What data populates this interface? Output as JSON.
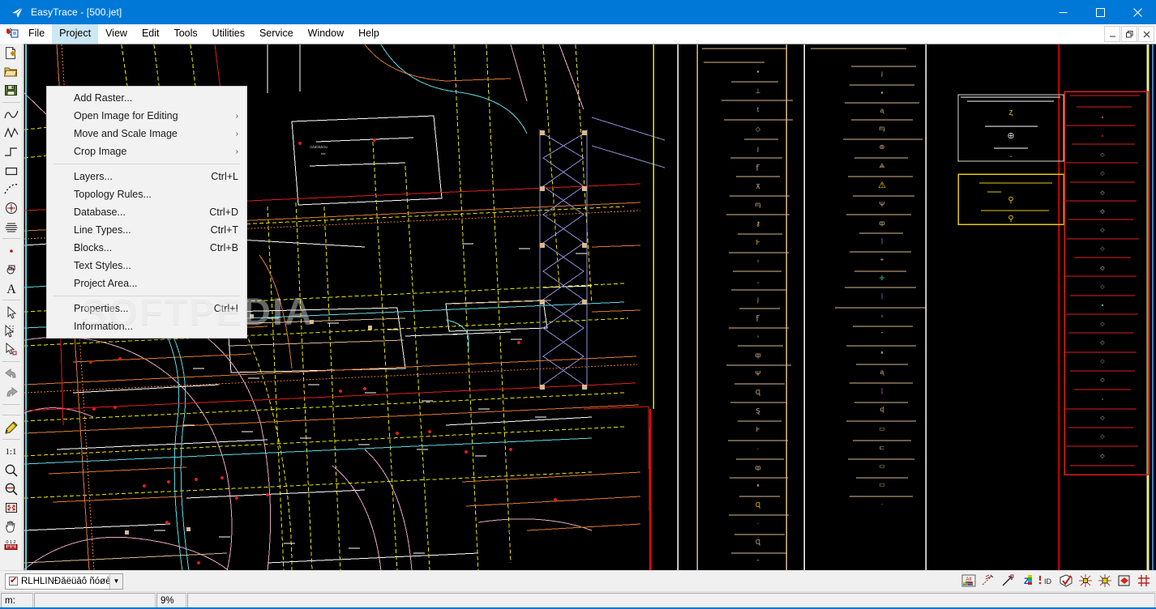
{
  "window": {
    "title": "EasyTrace - [500.jet]",
    "app_icon": "easytrace-logo-icon",
    "controls": {
      "minimize": "–",
      "maximize": "☐",
      "close": "✕"
    }
  },
  "mdi": {
    "doc_icon": "mdi-document-icon",
    "controls": {
      "minimize": "_",
      "restore": "❐",
      "close": "✕"
    }
  },
  "menubar": {
    "items": [
      {
        "label": "File",
        "name": "menu-file",
        "active": false
      },
      {
        "label": "Project",
        "name": "menu-project",
        "active": true
      },
      {
        "label": "View",
        "name": "menu-view",
        "active": false
      },
      {
        "label": "Edit",
        "name": "menu-edit",
        "active": false
      },
      {
        "label": "Tools",
        "name": "menu-tools",
        "active": false
      },
      {
        "label": "Utilities",
        "name": "menu-utilities",
        "active": false
      },
      {
        "label": "Service",
        "name": "menu-service",
        "active": false
      },
      {
        "label": "Window",
        "name": "menu-window",
        "active": false
      },
      {
        "label": "Help",
        "name": "menu-help",
        "active": false
      }
    ]
  },
  "project_menu": {
    "items": [
      {
        "label": "Add Raster...",
        "accel": "",
        "submenu": false
      },
      {
        "label": "Open Image for Editing",
        "accel": "",
        "submenu": true
      },
      {
        "label": "Move and Scale Image",
        "accel": "",
        "submenu": true
      },
      {
        "label": "Crop Image",
        "accel": "",
        "submenu": true
      },
      {
        "separator": true
      },
      {
        "label": "Layers...",
        "accel": "Ctrl+L",
        "submenu": false
      },
      {
        "label": "Topology Rules...",
        "accel": "",
        "submenu": false
      },
      {
        "label": "Database...",
        "accel": "Ctrl+D",
        "submenu": false
      },
      {
        "label": "Line Types...",
        "accel": "Ctrl+T",
        "submenu": false
      },
      {
        "label": "Blocks...",
        "accel": "Ctrl+B",
        "submenu": false
      },
      {
        "label": "Text Styles...",
        "accel": "",
        "submenu": false
      },
      {
        "label": "Project Area...",
        "accel": "",
        "submenu": false
      },
      {
        "separator": true
      },
      {
        "label": "Properties...",
        "accel": "Ctrl+I",
        "submenu": false
      },
      {
        "label": "Information...",
        "accel": "",
        "submenu": false
      }
    ],
    "submenu_arrow": "›"
  },
  "left_toolbar": {
    "groups": [
      {
        "buttons": [
          {
            "name": "new-document-button",
            "icon": "new-document-icon"
          },
          {
            "name": "open-folder-button",
            "icon": "open-folder-icon"
          },
          {
            "name": "save-button",
            "icon": "floppy-disk-icon"
          }
        ]
      },
      {
        "buttons": [
          {
            "name": "spline-tool-button",
            "icon": "smooth-curve-icon"
          },
          {
            "name": "polyline-tool-button",
            "icon": "polyline-icon"
          },
          {
            "name": "step-line-tool-button",
            "icon": "step-line-icon"
          },
          {
            "name": "rectangle-tool-button",
            "icon": "rectangle-icon"
          },
          {
            "name": "dashed-arc-tool-button",
            "icon": "dashed-arc-icon"
          },
          {
            "name": "circle-point-tool-button",
            "icon": "circle-with-point-icon"
          },
          {
            "name": "hatch-tool-button",
            "icon": "hatch-lines-icon"
          }
        ]
      },
      {
        "buttons": [
          {
            "name": "point-tool-button",
            "icon": "point-icon"
          },
          {
            "name": "block-tool-button",
            "icon": "block-symbol-icon"
          },
          {
            "name": "text-tool-button",
            "icon": "text-A-icon"
          }
        ]
      },
      {
        "buttons": [
          {
            "name": "select-arrow-button",
            "icon": "arrow-cursor-icon"
          },
          {
            "name": "select-multi-button",
            "icon": "multi-select-icon"
          },
          {
            "name": "select-region-button",
            "icon": "arrow-with-box-icon"
          }
        ]
      },
      {
        "buttons": [
          {
            "name": "undo-button",
            "icon": "undo-arrow-icon"
          },
          {
            "name": "redo-button",
            "icon": "redo-arrow-icon"
          }
        ]
      },
      {
        "buttons": [
          {
            "name": "edit-pencil-button",
            "icon": "pencil-icon"
          }
        ]
      },
      {
        "buttons": [
          {
            "name": "zoom-actual-button",
            "icon": "one-to-one-icon",
            "text": "1:1"
          },
          {
            "name": "zoom-in-button",
            "icon": "magnifier-icon"
          },
          {
            "name": "zoom-out-button",
            "icon": "magnifier-minus-icon"
          },
          {
            "name": "zoom-fit-button",
            "icon": "zoom-extents-icon"
          },
          {
            "name": "pan-hand-button",
            "icon": "hand-pan-icon"
          },
          {
            "name": "measure-button",
            "icon": "ruler-measure-icon"
          }
        ]
      }
    ]
  },
  "layer_bar": {
    "combo": {
      "name": "active-layer-combo",
      "checked": true,
      "value": "RLHLINÐåëüåô ñóøè",
      "arrow": "▼"
    }
  },
  "status_icons": [
    {
      "name": "attributes-toggle-icon",
      "label": "Att"
    },
    {
      "name": "snap-to-line-icon",
      "label": ""
    },
    {
      "name": "snap-to-node-icon",
      "label": ""
    },
    {
      "name": "z-color-palette-icon",
      "label": "Z"
    },
    {
      "name": "id-marker-icon",
      "label": "!ID"
    },
    {
      "name": "topology-check-icon",
      "label": ""
    },
    {
      "name": "vertex-snap-icon",
      "label": ""
    },
    {
      "name": "vertex-snap-alt-icon",
      "label": ""
    },
    {
      "name": "polygon-fill-icon",
      "label": ""
    },
    {
      "name": "grid-snap-icon",
      "label": ""
    }
  ],
  "status_bar": {
    "scale_label": "m:",
    "progress_value": "",
    "zoom": "9%",
    "message": ""
  },
  "watermark": {
    "text": "SOFTPEDIA"
  },
  "canvas": {
    "name": "cad-drawing-canvas",
    "background": "#000000",
    "description": "Engineering utility network map with colored vector layers and symbol legend panels",
    "palette": {
      "red": "#e01b1b",
      "yellow": "#e8e800",
      "orange": "#e07820",
      "cyan": "#5fd8e0",
      "pink": "#e8a8c0",
      "white": "#ffffff",
      "tan": "#d8b890",
      "purple": "#8f8fd8",
      "gold": "#ffd000"
    }
  }
}
